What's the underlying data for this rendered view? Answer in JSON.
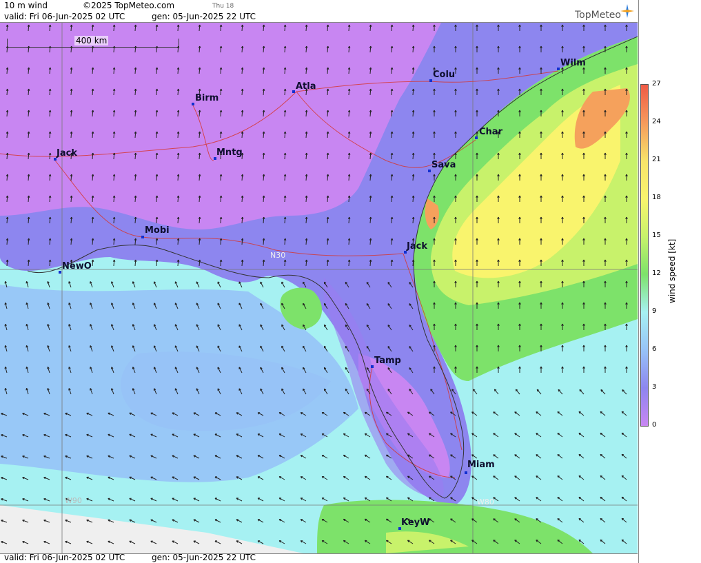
{
  "header": {
    "variable": "10 m wind",
    "copyright": "©2025 TopMeteo.com",
    "day_note": "Thu 18",
    "valid": "valid:  Fri  06-Jun-2025  02 UTC",
    "gen": "gen: 05-Jun-2025 22 UTC",
    "logo": "TopMeteo"
  },
  "footer": {
    "valid": "valid:  Fri  06-Jun-2025  02 UTC",
    "gen": "gen: 05-Jun-2025 22 UTC"
  },
  "scale_bar": {
    "label": "400 km"
  },
  "grid_labels": {
    "lat30": "N30",
    "lon90": "W90",
    "lon80": "W80"
  },
  "legend": {
    "title": "wind speed [kt]",
    "ticks": [
      "27",
      "24",
      "21",
      "18",
      "15",
      "12",
      "9",
      "6",
      "3",
      "0"
    ],
    "colors": [
      "#ef5b46",
      "#f59a5c",
      "#f7e36a",
      "#f9f46d",
      "#c8f26b",
      "#7de26a",
      "#a6f1f2",
      "#97c3f7",
      "#8d86ef",
      "#c886f2"
    ]
  },
  "cities": [
    {
      "name": "Wilm"
    },
    {
      "name": "Colu"
    },
    {
      "name": "Atla"
    },
    {
      "name": "Birm"
    },
    {
      "name": "Char"
    },
    {
      "name": "Jack"
    },
    {
      "name": "Mntg"
    },
    {
      "name": "Sava"
    },
    {
      "name": "Mobi"
    },
    {
      "name": "Jack"
    },
    {
      "name": "NewO"
    },
    {
      "name": "Tamp"
    },
    {
      "name": "Miam"
    },
    {
      "name": "KeyW"
    }
  ]
}
